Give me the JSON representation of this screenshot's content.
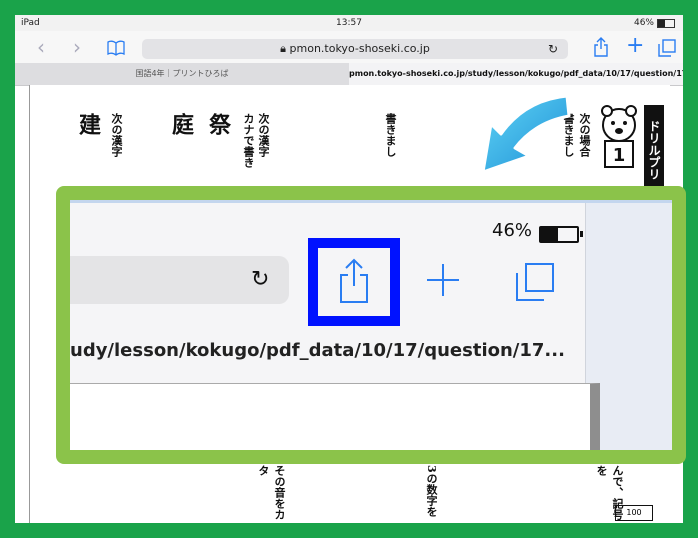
{
  "status": {
    "device": "iPad",
    "time": "13:57",
    "battery": "46%",
    "battery_level": 0.46
  },
  "nav": {
    "url": "pmon.tokyo-shoseki.co.jp"
  },
  "tabs": [
    {
      "label": "国語4年｜プリントひろば"
    },
    {
      "label": "pmon.tokyo-shoseki.co.jp/study/lesson/kokugo/pdf_data/10/17/question/17..."
    }
  ],
  "page": {
    "kanji1": "建",
    "kanji2": "庭",
    "kanji3": "祭",
    "col1": "次の漢字",
    "col2": "カナで書き",
    "col3": "次の漢字",
    "col4": "書きまし",
    "col5": "次の場合",
    "col6": "書きまし",
    "badge_drill": "ドリル",
    "badge_print": "プリ",
    "bottom1": "その音をカタ",
    "bottom2": "3の数字を",
    "bottom3": "んで、記号を",
    "score": "100"
  },
  "zoom": {
    "battery": "46%",
    "address": "udy/lesson/kokugo/pdf_data/10/17/question/17..."
  },
  "colors": {
    "frame": "#1aa34a",
    "zoom_border": "#8bc34a",
    "highlight": "#0012ff",
    "ios_blue": "#2a7df2"
  },
  "icons": [
    "back-icon",
    "forward-icon",
    "bookmarks-icon",
    "lock-icon",
    "reload-icon",
    "share-icon",
    "new-tab-icon",
    "tabs-icon",
    "battery-icon",
    "curved-arrow-icon",
    "bear-mascot-icon"
  ]
}
